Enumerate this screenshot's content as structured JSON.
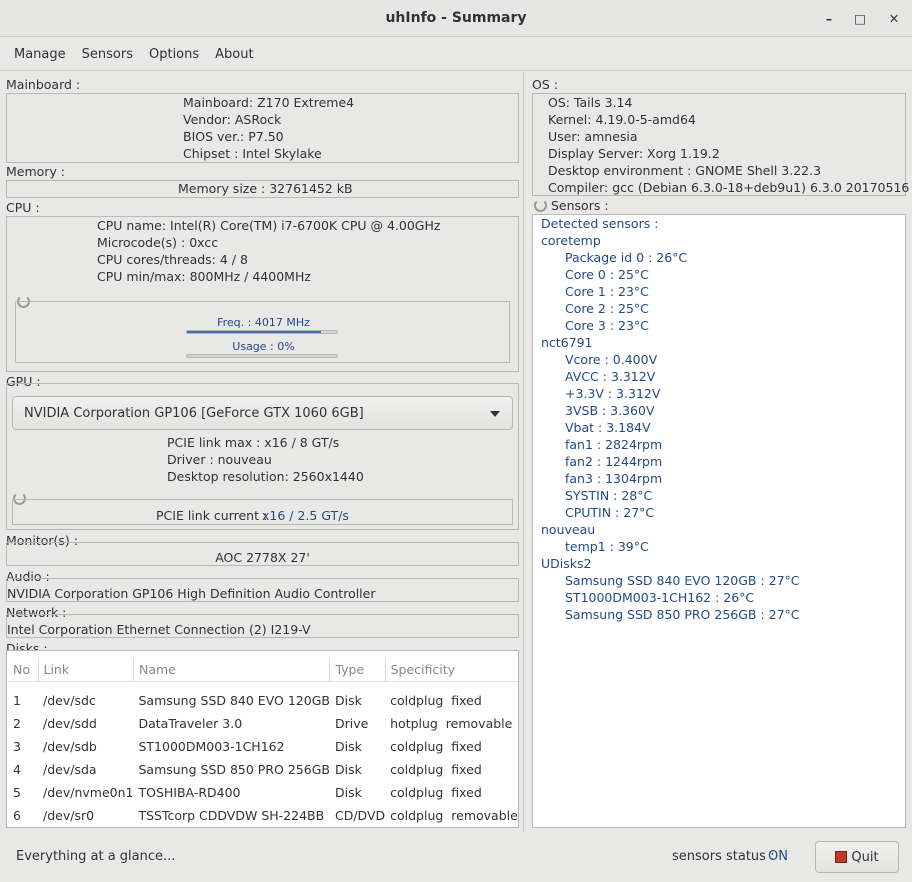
{
  "window": {
    "title": "uhInfo - Summary"
  },
  "menu": {
    "items": [
      "Manage",
      "Sensors",
      "Options",
      "About"
    ]
  },
  "mainboard": {
    "label": "Mainboard :",
    "lines": [
      "Mainboard: Z170 Extreme4",
      "Vendor: ASRock",
      "BIOS ver.: P7.50",
      "Chipset : Intel Skylake"
    ]
  },
  "memory": {
    "label": "Memory :",
    "size": "Memory size : 32761452 kB"
  },
  "cpu": {
    "label": "CPU :",
    "lines": [
      "CPU name: Intel(R) Core(TM) i7-6700K CPU @ 4.00GHz",
      "Microcode(s) : 0xcc",
      "CPU cores/threads: 4 / 8",
      "CPU min/max: 800MHz / 4400MHz"
    ],
    "freq_label": "Freq. : 4017 MHz",
    "freq_fraction": 0.89,
    "usage_label": "Usage : 0%",
    "usage_fraction": 0.0
  },
  "gpu": {
    "label": "GPU :",
    "selected": "NVIDIA Corporation GP106 [GeForce GTX 1060 6GB]",
    "lines": [
      "PCIE link max : x16 / 8 GT/s",
      "Driver : nouveau",
      "Desktop resolution: 2560x1440"
    ],
    "pcie_current_label": "PCIE link current :",
    "pcie_current_value": "x16 / 2.5 GT/s"
  },
  "monitors": {
    "label": "Monitor(s) :",
    "value": "AOC 2778X  27'"
  },
  "audio": {
    "label": "Audio :",
    "value": "NVIDIA Corporation GP106 High Definition Audio Controller"
  },
  "network": {
    "label": "Network :",
    "value": "Intel Corporation Ethernet Connection (2) I219-V"
  },
  "disks": {
    "label": "Disks :",
    "columns": [
      "No",
      "Link",
      "Name",
      "Type",
      "Specificity"
    ],
    "rows": [
      [
        "1",
        "/dev/sdc",
        "Samsung SSD 840 EVO 120GB",
        "Disk",
        "coldplug  fixed"
      ],
      [
        "2",
        "/dev/sdd",
        "DataTraveler 3.0",
        "Drive",
        "hotplug  removable"
      ],
      [
        "3",
        "/dev/sdb",
        "ST1000DM003-1CH162",
        "Disk",
        "coldplug  fixed"
      ],
      [
        "4",
        "/dev/sda",
        "Samsung SSD 850 PRO 256GB",
        "Disk",
        "coldplug  fixed"
      ],
      [
        "5",
        "/dev/nvme0n1",
        "TOSHIBA-RD400",
        "Disk",
        "coldplug  fixed"
      ],
      [
        "6",
        "/dev/sr0",
        "TSSTcorp CDDVDW SH-224BB",
        "CD/DVD",
        "coldplug  removable"
      ]
    ]
  },
  "os": {
    "label": "OS :",
    "lines": [
      "OS: Tails 3.14",
      "Kernel: 4.19.0-5-amd64",
      "User: amnesia",
      "Display Server: Xorg 1.19.2",
      "Desktop environment : GNOME Shell 3.22.3",
      "Compiler: gcc (Debian 6.3.0-18+deb9u1) 6.3.0 20170516"
    ]
  },
  "sensors": {
    "label": "Sensors :",
    "lines": [
      {
        "text": "Detected sensors :",
        "level": 0
      },
      {
        "text": "coretemp",
        "level": 0
      },
      {
        "text": "Package id 0 : 26°C",
        "level": 1
      },
      {
        "text": "Core 0 : 25°C",
        "level": 1
      },
      {
        "text": "Core 1 : 23°C",
        "level": 1
      },
      {
        "text": "Core 2 : 25°C",
        "level": 1
      },
      {
        "text": "Core 3 : 23°C",
        "level": 1
      },
      {
        "text": "nct6791",
        "level": 0
      },
      {
        "text": "Vcore : 0.400V",
        "level": 1
      },
      {
        "text": "AVCC : 3.312V",
        "level": 1
      },
      {
        "text": "+3.3V : 3.312V",
        "level": 1
      },
      {
        "text": "3VSB : 3.360V",
        "level": 1
      },
      {
        "text": "Vbat : 3.184V",
        "level": 1
      },
      {
        "text": "fan1 : 2824rpm",
        "level": 1
      },
      {
        "text": "fan2 : 1244rpm",
        "level": 1
      },
      {
        "text": "fan3 : 1304rpm",
        "level": 1
      },
      {
        "text": "SYSTIN : 28°C",
        "level": 1
      },
      {
        "text": "CPUTIN : 27°C",
        "level": 1
      },
      {
        "text": "nouveau",
        "level": 0
      },
      {
        "text": "temp1 : 39°C",
        "level": 1
      },
      {
        "text": "UDisks2",
        "level": 0
      },
      {
        "text": "Samsung SSD 840 EVO 120GB : 27°C",
        "level": 1
      },
      {
        "text": "ST1000DM003-1CH162 : 26°C",
        "level": 1
      },
      {
        "text": "Samsung SSD 850 PRO 256GB : 27°C",
        "level": 1
      }
    ]
  },
  "statusbar": {
    "message": "Everything at a glance...",
    "sensors_label": "sensors status :",
    "sensors_value": "ON",
    "quit_label": "Quit"
  },
  "colors": {
    "accent": "#234a86",
    "progress": "#3f6fb5",
    "quit_icon": "#c0392b"
  }
}
